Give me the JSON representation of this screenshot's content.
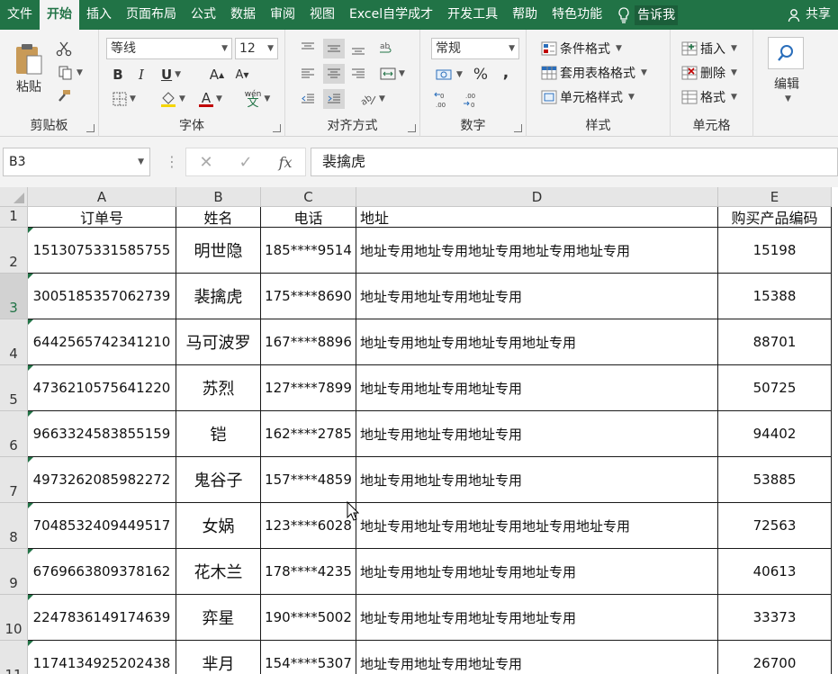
{
  "tabs": [
    "文件",
    "开始",
    "插入",
    "页面布局",
    "公式",
    "数据",
    "审阅",
    "视图",
    "Excel自学成才",
    "开发工具",
    "帮助",
    "特色功能"
  ],
  "active_tab_index": 1,
  "tell_me": "告诉我",
  "share": "共享",
  "ribbon": {
    "clipboard": {
      "label": "剪贴板",
      "paste": "粘贴"
    },
    "font": {
      "label": "字体",
      "font_name": "等线",
      "font_size": "12",
      "bold": "B",
      "italic": "I",
      "underline": "U",
      "grow": "A",
      "shrink": "A",
      "font_color": "A",
      "phonetic": "wén"
    },
    "alignment": {
      "label": "对齐方式"
    },
    "number": {
      "label": "数字",
      "format": "常规",
      "percent": "%",
      "comma": ","
    },
    "styles": {
      "label": "样式",
      "conditional": "条件格式",
      "table": "套用表格格式",
      "cell_styles": "单元格样式"
    },
    "cells": {
      "label": "单元格",
      "insert": "插入",
      "delete": "删除",
      "format": "格式"
    },
    "editing": {
      "label": "编辑"
    }
  },
  "formula_bar": {
    "name_box": "B3",
    "content": "裴擒虎",
    "fx": "fx"
  },
  "accent_color": "#217346",
  "columns": [
    "A",
    "B",
    "C",
    "D",
    "E"
  ],
  "row_numbers": [
    "1",
    "2",
    "3",
    "4",
    "5",
    "6",
    "7",
    "8",
    "9",
    "10",
    "11"
  ],
  "table": {
    "headers": [
      "订单号",
      "姓名",
      "电话",
      "地址",
      "购买产品编码"
    ],
    "rows": [
      [
        "1513075331585755",
        "明世隐",
        "185****9514",
        "地址专用地址专用地址专用地址专用地址专用",
        "15198"
      ],
      [
        "3005185357062739",
        "裴擒虎",
        "175****8690",
        "地址专用地址专用地址专用",
        "15388"
      ],
      [
        "6442565742341210",
        "马可波罗",
        "167****8896",
        "地址专用地址专用地址专用地址专用",
        "88701"
      ],
      [
        "4736210575641220",
        "苏烈",
        "127****7899",
        "地址专用地址专用地址专用",
        "50725"
      ],
      [
        "9663324583855159",
        "铠",
        "162****2785",
        "地址专用地址专用地址专用",
        "94402"
      ],
      [
        "4973262085982272",
        "鬼谷子",
        "157****4859",
        "地址专用地址专用地址专用",
        "53885"
      ],
      [
        "7048532409449517",
        "女娲",
        "123****6028",
        "地址专用地址专用地址专用地址专用地址专用",
        "72563"
      ],
      [
        "6769663809378162",
        "花木兰",
        "178****4235",
        "地址专用地址专用地址专用地址专用",
        "40613"
      ],
      [
        "2247836149174639",
        "弈星",
        "190****5002",
        "地址专用地址专用地址专用地址专用",
        "33373"
      ],
      [
        "1174134925202438",
        "芈月",
        "154****5307",
        "地址专用地址专用地址专用",
        "26700"
      ]
    ]
  }
}
